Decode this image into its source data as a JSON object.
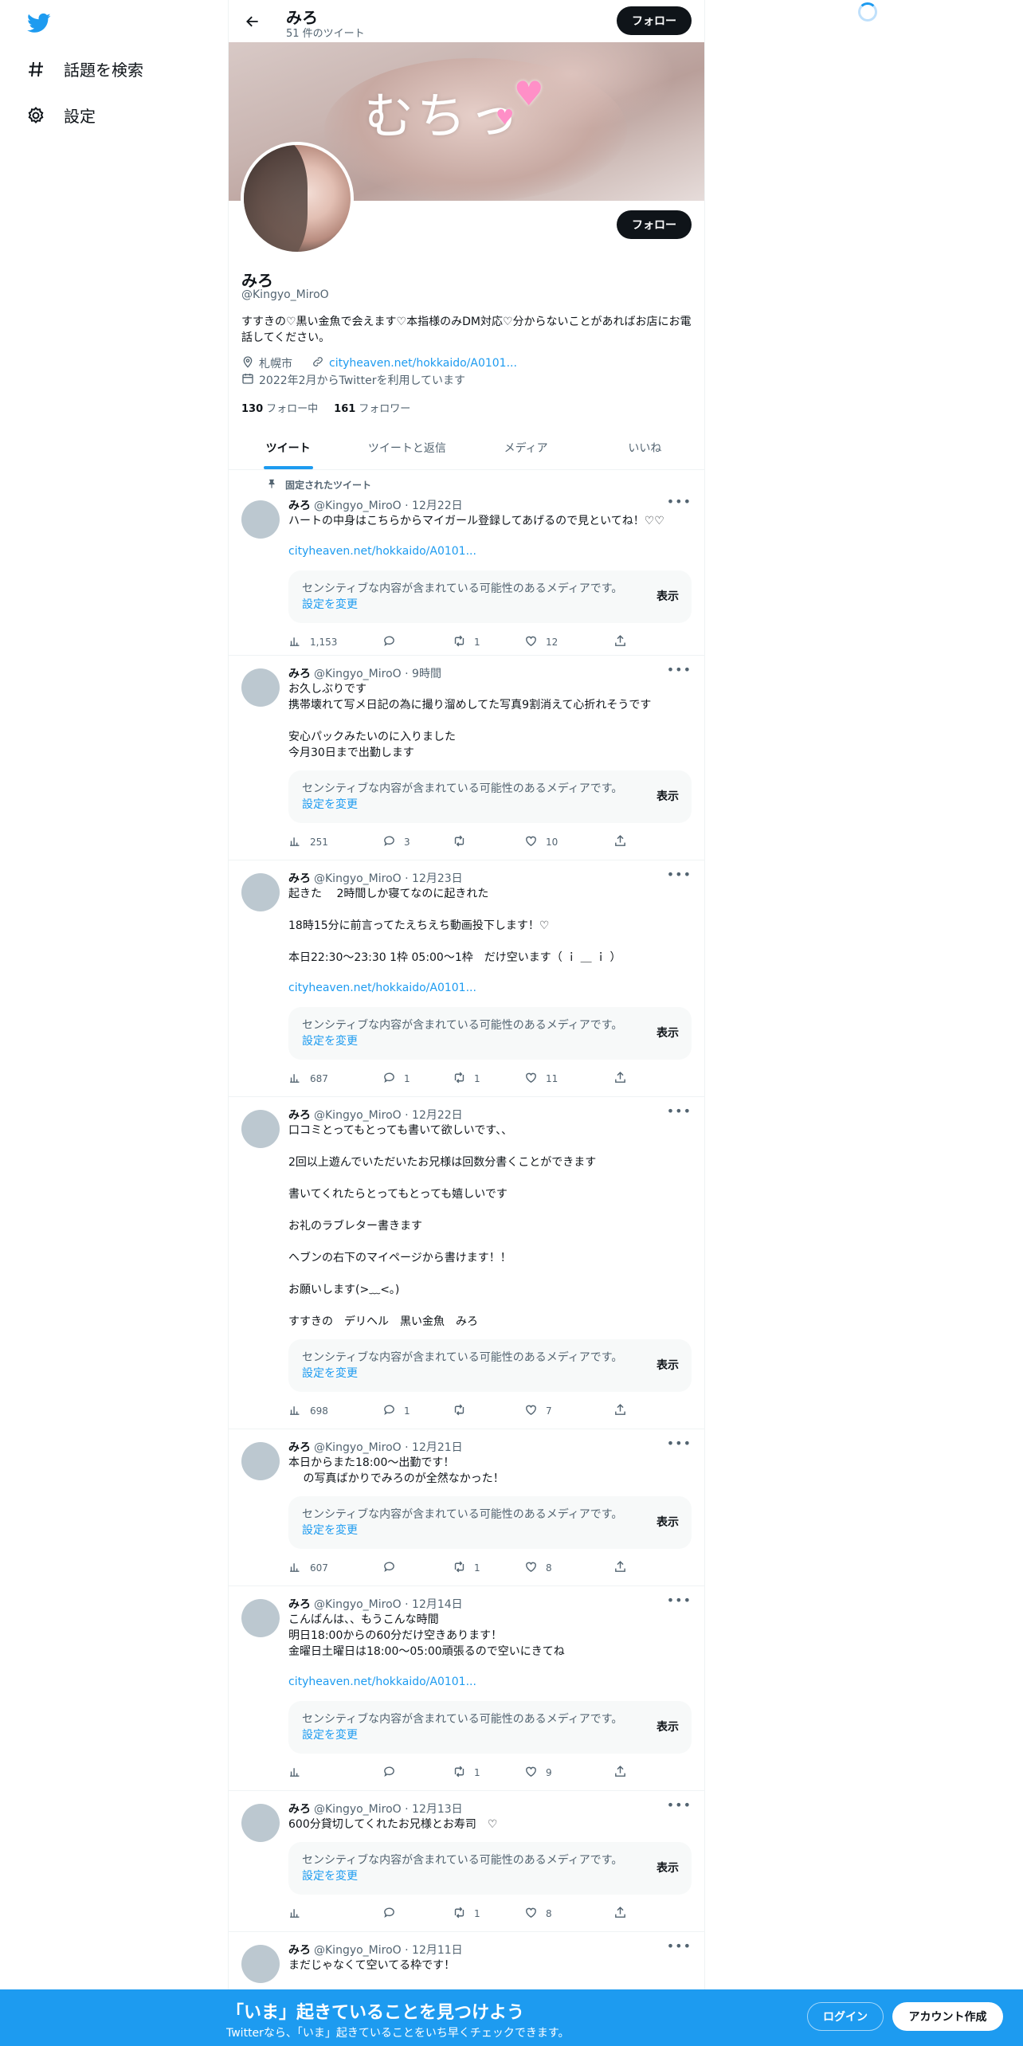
{
  "nav": {
    "items": [
      {
        "label": "話題を検索",
        "icon": "hashtag-icon"
      },
      {
        "label": "設定",
        "icon": "gear-icon"
      }
    ]
  },
  "header": {
    "name": "みろ",
    "tweet_count": "51 件のツイート",
    "follow_label": "フォロー"
  },
  "profile": {
    "banner_text": "むちっ",
    "name": "みろ",
    "handle": "@Kingyo_MiroO",
    "follow_label": "フォロー",
    "bio": "すすきの♡黒い金魚で会えます♡本指様のみDM対応♡分からないことがあればお店にお電話してください。",
    "location": "札幌市",
    "website": "cityheaven.net/hokkaido/A0101...",
    "joined": "2022年2月からTwitterを利用しています",
    "following_count": "130",
    "following_label": "フォロー中",
    "followers_count": "161",
    "followers_label": "フォロワー"
  },
  "tabs": [
    {
      "label": "ツイート",
      "active": true
    },
    {
      "label": "ツイートと返信",
      "active": false
    },
    {
      "label": "メディア",
      "active": false
    },
    {
      "label": "いいね",
      "active": false
    }
  ],
  "sensitive": {
    "message": "センシティブな内容が含まれている可能性のあるメディアです。",
    "settings_link": "設定を変更",
    "show_label": "表示"
  },
  "tweets": [
    {
      "pinned_label": "固定されたツイート",
      "name": "みろ",
      "handle": "@Kingyo_MiroO",
      "time": "12月22日",
      "text": "ハートの中身はこちらからマイガール登録してあげるので見といてね！♡♡",
      "link": "cityheaven.net/hokkaido/A0101...",
      "views": "1,153",
      "replies": "",
      "retweets": "1",
      "likes": "12"
    },
    {
      "name": "みろ",
      "handle": "@Kingyo_MiroO",
      "time": "9時間",
      "text": "お久しぶりです\n携帯壊れて写メ日記の為に撮り溜めしてた写真9割消えて心折れそうです\n\n安心パックみたいのに入りました\n今月30日まで出勤します",
      "views": "251",
      "replies": "3",
      "retweets": "",
      "likes": "10"
    },
    {
      "name": "みろ",
      "handle": "@Kingyo_MiroO",
      "time": "12月23日",
      "text": "起きた　 2時間しか寝てなのに起きれた\n\n18時15分に前言ってたえちえち動画投下します！♡\n\n本日22:30〜23:30 1枠 05:00〜1枠　だけ空います（ ｉ ＿ ｉ ）",
      "link": "cityheaven.net/hokkaido/A0101...",
      "views": "687",
      "replies": "1",
      "retweets": "1",
      "likes": "11"
    },
    {
      "name": "みろ",
      "handle": "@Kingyo_MiroO",
      "time": "12月22日",
      "text": "口コミとってもとっても書いて欲しいです、、\n\n2回以上遊んでいただいたお兄様は回数分書くことができます\n\n書いてくれたらとってもとっても嬉しいです\n\nお礼のラブレター書きます\n\nヘブンの右下のマイページから書けます！！\n\nお願いします(>﹏<｡)\n\nすすきの　デリヘル　黒い金魚　みろ",
      "views": "698",
      "replies": "1",
      "retweets": "",
      "likes": "7"
    },
    {
      "name": "みろ",
      "handle": "@Kingyo_MiroO",
      "time": "12月21日",
      "text": "本日からまた18:00〜出勤です！\n　 の写真ばかりでみろのが全然なかった！",
      "views": "607",
      "replies": "",
      "retweets": "1",
      "likes": "8"
    },
    {
      "name": "みろ",
      "handle": "@Kingyo_MiroO",
      "time": "12月14日",
      "text": "こんばんは、、もうこんな時間\n明日18:00からの60分だけ空きあります！\n金曜日土曜日は18:00〜05:00頑張るので空いにきてね",
      "link": "cityheaven.net/hokkaido/A0101...",
      "views": "",
      "replies": "",
      "retweets": "1",
      "likes": "9"
    },
    {
      "name": "みろ",
      "handle": "@Kingyo_MiroO",
      "time": "12月13日",
      "text": "600分貸切してくれたお兄様とお寿司　♡",
      "views": "",
      "replies": "",
      "retweets": "1",
      "likes": "8"
    },
    {
      "name": "みろ",
      "handle": "@Kingyo_MiroO",
      "time": "12月11日",
      "text": "まだじゃなくて空いてる枠です！"
    }
  ],
  "bottom_bar": {
    "title": "「いま」起きていることを見つけよう",
    "subtitle": "Twitterなら、「いま」起きていることをいち早くチェックできます。",
    "login_label": "ログイン",
    "signup_label": "アカウント作成"
  },
  "colors": {
    "accent": "#1d9bf0",
    "text": "#0f1419",
    "muted": "#536471",
    "border": "#eff3f4"
  }
}
